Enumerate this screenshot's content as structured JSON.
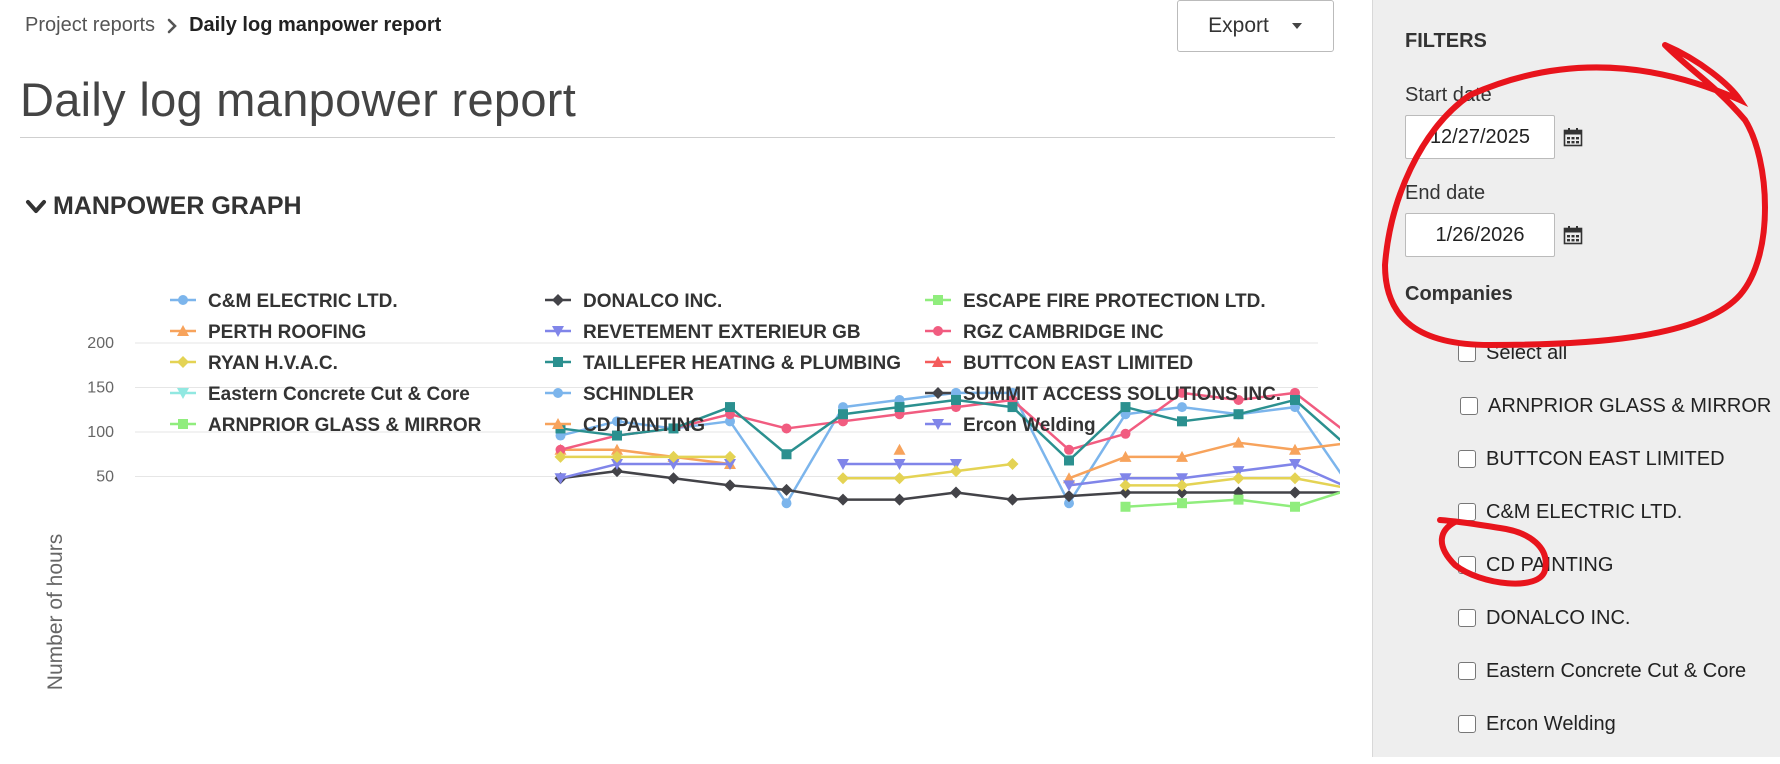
{
  "breadcrumb": {
    "parent": "Project reports",
    "current": "Daily log manpower report"
  },
  "toolbar": {
    "export_label": "Export"
  },
  "page": {
    "title": "Daily log manpower report"
  },
  "section": {
    "title": "MANPOWER GRAPH"
  },
  "filters": {
    "title": "FILTERS",
    "start_label": "Start date",
    "start_value": "12/27/2025",
    "end_label": "End date",
    "end_value": "1/26/2026",
    "companies_label": "Companies",
    "companies": [
      "Select all",
      "ARNPRIOR GLASS & MIRROR",
      "BUTTCON EAST LIMITED",
      "C&M ELECTRIC LTD.",
      "CD PAINTING",
      "DONALCO INC.",
      "Eastern Concrete Cut & Core",
      "Ercon Welding"
    ]
  },
  "annotation": {
    "color": "#e8141c"
  },
  "chart_data": {
    "type": "line",
    "title": "",
    "xlabel": "",
    "ylabel": "Number of hours",
    "ylim": [
      0,
      200
    ],
    "yticks": [
      50,
      100,
      150,
      200
    ],
    "grid": true,
    "legend_position": "top",
    "x": [
      1,
      2,
      3,
      4,
      5,
      6,
      7,
      8,
      9,
      10,
      11,
      12,
      13,
      14,
      15,
      16,
      17,
      18,
      19,
      20,
      21,
      22,
      23,
      24,
      25,
      26,
      27,
      28,
      29,
      30
    ],
    "series": [
      {
        "name": "C&M ELECTRIC LTD.",
        "color": "#7cb5ec",
        "marker": "circle",
        "values": [
          null,
          null,
          null,
          null,
          null,
          null,
          null,
          96,
          112,
          104,
          112,
          20,
          128,
          136,
          144,
          144,
          20,
          120,
          128,
          120,
          128,
          36,
          36,
          null,
          null,
          null,
          null,
          null,
          null,
          null
        ]
      },
      {
        "name": "DONALCO INC.",
        "color": "#434348",
        "marker": "diamond",
        "values": [
          null,
          null,
          null,
          null,
          null,
          null,
          null,
          48,
          56,
          48,
          40,
          35,
          24,
          24,
          32,
          24,
          28,
          32,
          32,
          32,
          32,
          32,
          32,
          null,
          null,
          null,
          null,
          null,
          null,
          null
        ]
      },
      {
        "name": "ESCAPE FIRE PROTECTION LTD.",
        "color": "#90ed7d",
        "marker": "square",
        "values": [
          null,
          null,
          null,
          null,
          null,
          null,
          null,
          null,
          null,
          null,
          null,
          null,
          null,
          null,
          null,
          null,
          null,
          16,
          20,
          24,
          16,
          36,
          36,
          null,
          null,
          null,
          null,
          null,
          null,
          null
        ]
      },
      {
        "name": "PERTH ROOFING",
        "color": "#f7a35c",
        "marker": "triangle",
        "values": [
          null,
          null,
          null,
          null,
          null,
          null,
          null,
          80,
          80,
          72,
          64,
          null,
          null,
          80,
          null,
          null,
          48,
          72,
          72,
          88,
          80,
          88,
          88,
          null,
          null,
          null,
          null,
          null,
          null,
          null
        ]
      },
      {
        "name": "REVETEMENT EXTERIEUR GB",
        "color": "#8085e9",
        "marker": "triangle-down",
        "values": [
          null,
          null,
          null,
          null,
          null,
          null,
          null,
          48,
          64,
          64,
          64,
          null,
          64,
          64,
          64,
          null,
          40,
          48,
          48,
          56,
          64,
          36,
          36,
          null,
          null,
          null,
          null,
          null,
          null,
          null
        ]
      },
      {
        "name": "RGZ CAMBRIDGE INC",
        "color": "#f15c80",
        "marker": "circle",
        "values": [
          null,
          null,
          null,
          null,
          null,
          null,
          null,
          80,
          96,
          104,
          120,
          104,
          112,
          120,
          128,
          136,
          80,
          98,
          144,
          136,
          144,
          95,
          95,
          null,
          null,
          null,
          null,
          null,
          null,
          null
        ]
      },
      {
        "name": "RYAN H.V.A.C.",
        "color": "#e4d354",
        "marker": "diamond",
        "values": [
          null,
          null,
          null,
          null,
          null,
          null,
          null,
          72,
          72,
          72,
          72,
          null,
          48,
          48,
          56,
          64,
          null,
          40,
          40,
          48,
          48,
          36,
          36,
          null,
          null,
          null,
          null,
          null,
          null,
          null
        ]
      },
      {
        "name": "TAILLEFER HEATING & PLUMBING",
        "color": "#2b908f",
        "marker": "square",
        "values": [
          null,
          null,
          null,
          null,
          null,
          null,
          null,
          104,
          96,
          104,
          128,
          75,
          120,
          128,
          136,
          128,
          68,
          128,
          112,
          120,
          136,
          80,
          80,
          null,
          null,
          null,
          null,
          null,
          null,
          null
        ]
      },
      {
        "name": "BUTTCON EAST LIMITED",
        "color": "#f45b5b",
        "marker": "triangle",
        "values": []
      },
      {
        "name": "Eastern Concrete Cut & Core",
        "color": "#91e8e1",
        "marker": "triangle-down",
        "values": []
      },
      {
        "name": "SCHINDLER",
        "color": "#7cb5ec",
        "marker": "circle",
        "values": []
      },
      {
        "name": "SUMMIT ACCESS SOLUTIONS INC.",
        "color": "#434348",
        "marker": "diamond",
        "values": []
      },
      {
        "name": "ARNPRIOR GLASS & MIRROR",
        "color": "#90ed7d",
        "marker": "square",
        "values": []
      },
      {
        "name": "CD PAINTING",
        "color": "#f7a35c",
        "marker": "triangle",
        "values": []
      },
      {
        "name": "Ercon Welding",
        "color": "#8085e9",
        "marker": "triangle-down",
        "values": []
      }
    ]
  }
}
